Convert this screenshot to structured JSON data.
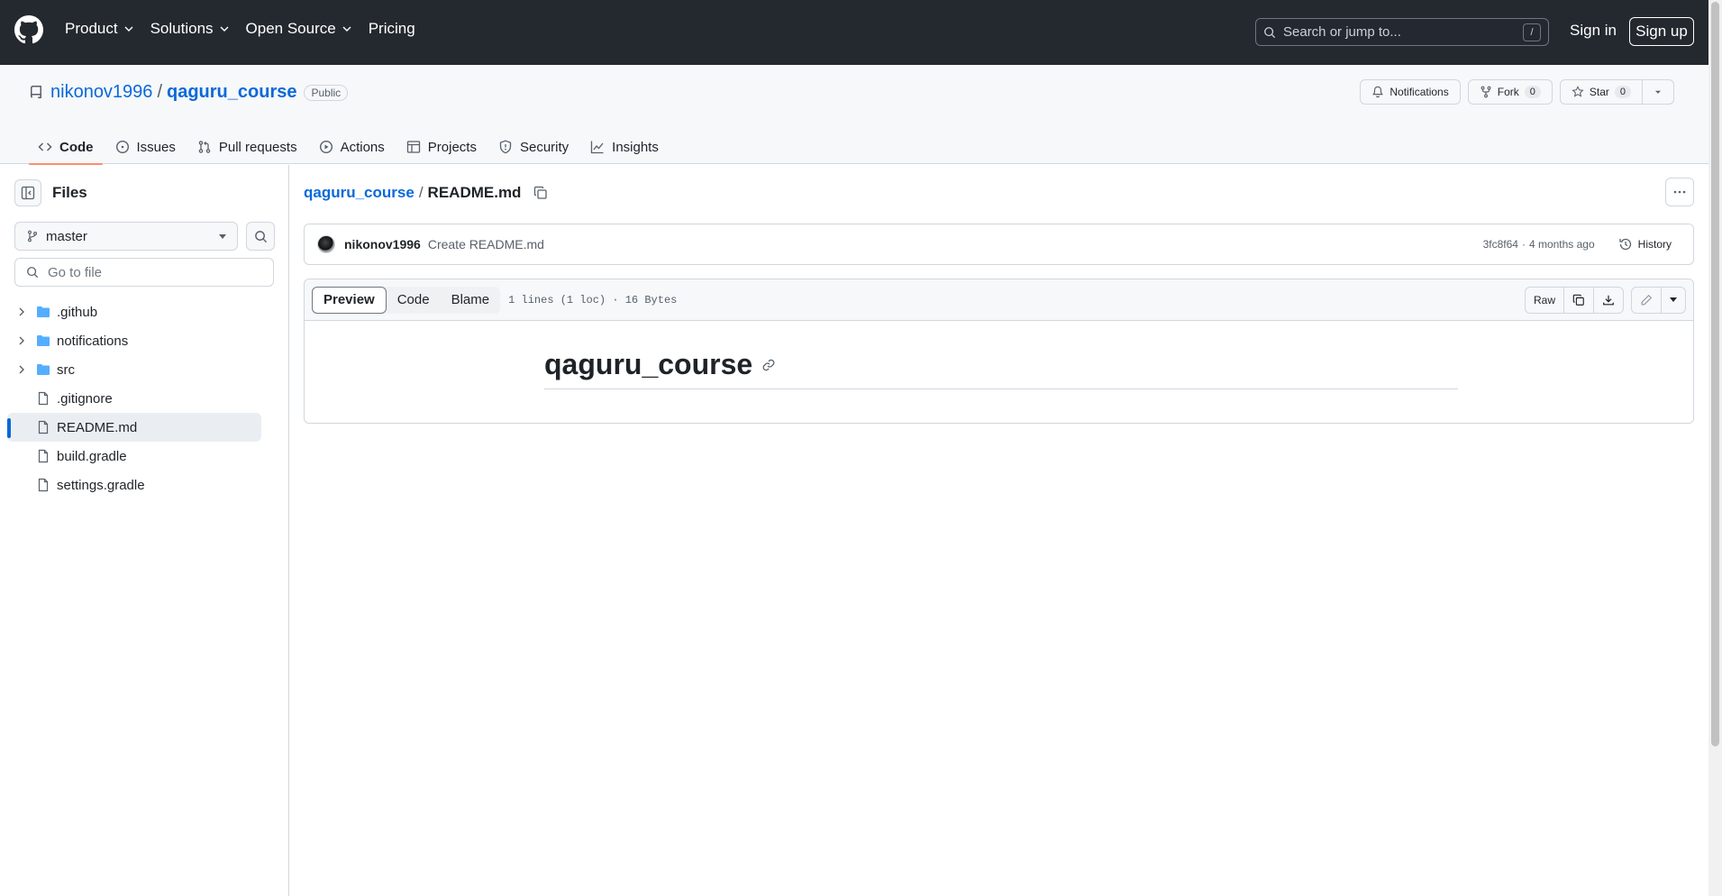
{
  "header": {
    "nav": [
      "Product",
      "Solutions",
      "Open Source",
      "Pricing"
    ],
    "search_placeholder": "Search or jump to...",
    "search_shortcut": "/",
    "sign_in": "Sign in",
    "sign_up": "Sign up"
  },
  "repo": {
    "owner": "nikonov1996",
    "separator": "/",
    "name": "qaguru_course",
    "visibility": "Public",
    "notifications_label": "Notifications",
    "fork_label": "Fork",
    "fork_count": "0",
    "star_label": "Star",
    "star_count": "0",
    "tabs": [
      "Code",
      "Issues",
      "Pull requests",
      "Actions",
      "Projects",
      "Security",
      "Insights"
    ]
  },
  "sidebar": {
    "title": "Files",
    "branch": "master",
    "goto_placeholder": "Go to file",
    "items": [
      {
        "label": ".github",
        "type": "folder"
      },
      {
        "label": "notifications",
        "type": "folder"
      },
      {
        "label": "src",
        "type": "folder"
      },
      {
        "label": ".gitignore",
        "type": "file"
      },
      {
        "label": "README.md",
        "type": "file",
        "selected": true
      },
      {
        "label": "build.gradle",
        "type": "file"
      },
      {
        "label": "settings.gradle",
        "type": "file"
      }
    ]
  },
  "main": {
    "breadcrumb_repo": "qaguru_course",
    "breadcrumb_sep": "/",
    "breadcrumb_file": "README.md",
    "commit": {
      "author": "nikonov1996",
      "message": "Create README.md",
      "sha": "3fc8f64",
      "dot": "·",
      "age": "4 months ago",
      "history_label": "History"
    },
    "view_tabs": [
      "Preview",
      "Code",
      "Blame"
    ],
    "file_info": "1 lines (1 loc) · 16 Bytes",
    "raw_label": "Raw",
    "readme_heading": "qaguru_course"
  },
  "colors": {
    "header_bg": "#24292f",
    "link": "#0969da",
    "active_tab_underline": "#fd8c73"
  }
}
